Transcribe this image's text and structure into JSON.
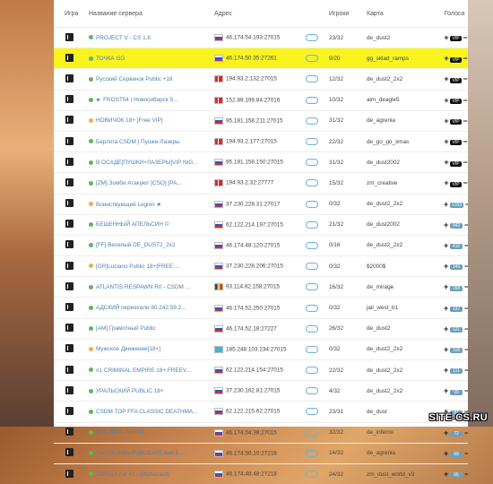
{
  "headers": {
    "game": "Игра",
    "name": "Название сервера",
    "addr": "Адрес",
    "players": "Игроки",
    "map": "Карта",
    "votes": "Голоса"
  },
  "watermark": "SITE-CS.RU",
  "colors": {
    "highlight": "#f9f41e",
    "link": "#4a7fb5",
    "online": "#5cb85c",
    "warn": "#f0ad4e"
  },
  "rows": [
    {
      "game_icon": "cs-icon",
      "status": "online",
      "name": "PROJECT V - CS 1.6",
      "flag": "ru",
      "addr": "46.174.54.193:27015",
      "players": "23/32",
      "map": "de_dust2",
      "vote": "vip"
    },
    {
      "game_icon": "cs-icon",
      "status": "online",
      "name": "ТОЧКА GG",
      "flag": "ru",
      "addr": "46.174.50.35:27261",
      "players": "9/20",
      "map": "gg_sklad_ramps",
      "vote": "vip",
      "highlight": true
    },
    {
      "game_icon": "cs-icon",
      "status": "online",
      "name": "Русский Сервачок Public +18",
      "flag": "dk",
      "addr": "194.93.2.132:27015",
      "players": "12/32",
      "map": "de_dust2_2x2",
      "vote": "vip"
    },
    {
      "game_icon": "cs-icon",
      "status": "online",
      "name": "► FROST54 | Новосибирск 5...",
      "flag": "dk",
      "addr": "152.89.199.84:27016",
      "players": "10/32",
      "map": "aim_deagle5",
      "vote": "vip"
    },
    {
      "game_icon": "cs-icon",
      "status": "warn",
      "name": "НОВИЧОК 18+ [Free VIP]",
      "flag": "ru",
      "addr": "95.181.158.211:27015",
      "players": "31/32",
      "map": "de_agrenia",
      "vote": "vip"
    },
    {
      "game_icon": "cs-icon",
      "status": "online",
      "name": "Берлога CSDM | Пушки-Лазеры",
      "flag": "dk",
      "addr": "194.93.2.177:27015",
      "players": "22/32",
      "map": "de_go_go_xmas",
      "vote": "vip"
    },
    {
      "game_icon": "cs-icon",
      "status": "online",
      "name": "В ОСАДЕ[ПУШКИ+ЛАЗЕРЫ]VIP NIG...",
      "flag": "ru",
      "addr": "95.181.158.150:27015",
      "players": "31/32",
      "map": "de_dust2002",
      "vote": "vip"
    },
    {
      "game_icon": "cs-icon",
      "status": "online",
      "name": "[ZM] Зомби Атакуют [CSO] [PA...",
      "flag": "dk",
      "addr": "194.93.2.32:27777",
      "players": "15/32",
      "map": "zm_creative",
      "vote": "vip"
    },
    {
      "game_icon": "cs-icon",
      "status": "warn",
      "name": "Воинствующий Legion ★",
      "flag": "ru",
      "addr": "37.230.228.31:27017",
      "players": "0/32",
      "map": "de_dust2_2x2",
      "vote": "1053"
    },
    {
      "game_icon": "cs-icon",
      "status": "online",
      "name": "БЕШЕННЫЙ АПЕЛЬСИН ©",
      "flag": "ru",
      "addr": "62.122.214.197:27015",
      "players": "21/32",
      "map": "de_dust2002",
      "vote": "942"
    },
    {
      "game_icon": "cs-icon",
      "status": "online",
      "name": "[FF] Веселый DE_DUST2_2x2",
      "flag": "ru",
      "addr": "46.174.48.120:27015",
      "players": "0/16",
      "map": "de_dust2_2x2",
      "vote": "410"
    },
    {
      "game_icon": "cs-icon",
      "status": "warn",
      "name": "[GR]Luciano Public 18+[FREE ...",
      "flag": "ru",
      "addr": "37.230.228.206:27015",
      "players": "0/32",
      "map": "$2000$",
      "vote": "349"
    },
    {
      "game_icon": "cs-icon",
      "status": "online",
      "name": "ATLANTIS RESPAWN R0 - CSDM ...",
      "flag": "ro",
      "addr": "93.114.82.158:27015",
      "players": "16/32",
      "map": "de_mirage",
      "vote": "168"
    },
    {
      "game_icon": "cs-icon",
      "status": "online",
      "name": "АДСКИЙ переехали 80.242.59.2...",
      "flag": "ru",
      "addr": "46.174.52.250:27015",
      "players": "0/32",
      "map": "jail_west_b1",
      "vote": "137"
    },
    {
      "game_icon": "cs-icon",
      "status": "online",
      "name": "[AM] Грамотный Public",
      "flag": "ru",
      "addr": "46.174.52.18:27227",
      "players": "26/32",
      "map": "de_dust2",
      "vote": "121"
    },
    {
      "game_icon": "cs-icon",
      "status": "warn",
      "name": "Мужское Движение[18+]",
      "flag": "kz",
      "addr": "185.248.103.234:27015",
      "players": "0/32",
      "map": "de_dust2_2x2",
      "vote": "118"
    },
    {
      "game_icon": "cs-icon",
      "status": "online",
      "name": "#1 CRIMINAL EMPIRE 18+ FREEV...",
      "flag": "ru",
      "addr": "62.122.214.154:27015",
      "players": "22/32",
      "map": "de_dust2_2x2",
      "vote": "111"
    },
    {
      "game_icon": "cs-icon",
      "status": "online",
      "name": "УРАЛЬСКИЙ PUBLIC 18+",
      "flag": "ru",
      "addr": "37.230.162.81:27015",
      "players": "4/32",
      "map": "de_dust2_2x2",
      "vote": "90"
    },
    {
      "game_icon": "cs-icon",
      "status": "online",
      "name": "CSDM TOP FFA CLASSIC DEATHMA...",
      "flag": "ru",
      "addr": "62.122.215.62:27015",
      "players": "23/31",
      "map": "de_dust",
      "vote": "84"
    },
    {
      "game_icon": "cs-icon",
      "status": "online",
      "name": "RED BULL ARENA",
      "flag": "ru",
      "addr": "46.174.54.38:27015",
      "players": "32/32",
      "map": "de_inferno",
      "vote": "72"
    },
    {
      "game_icon": "cs-icon",
      "status": "online",
      "name": "Чистое Небо PUBLIC#25 нам 8 ...",
      "flag": "ru",
      "addr": "46.174.50.10:27216",
      "players": "14/32",
      "map": "de_agrenia",
      "vote": "69"
    },
    {
      "game_icon": "cs-icon",
      "status": "online",
      "name": "ZMRush.net #1 - [Biohazard]",
      "flag": "ru",
      "addr": "46.174.48.48:27218",
      "players": "24/32",
      "map": "zm_dust_world_v3",
      "vote": "65"
    }
  ]
}
